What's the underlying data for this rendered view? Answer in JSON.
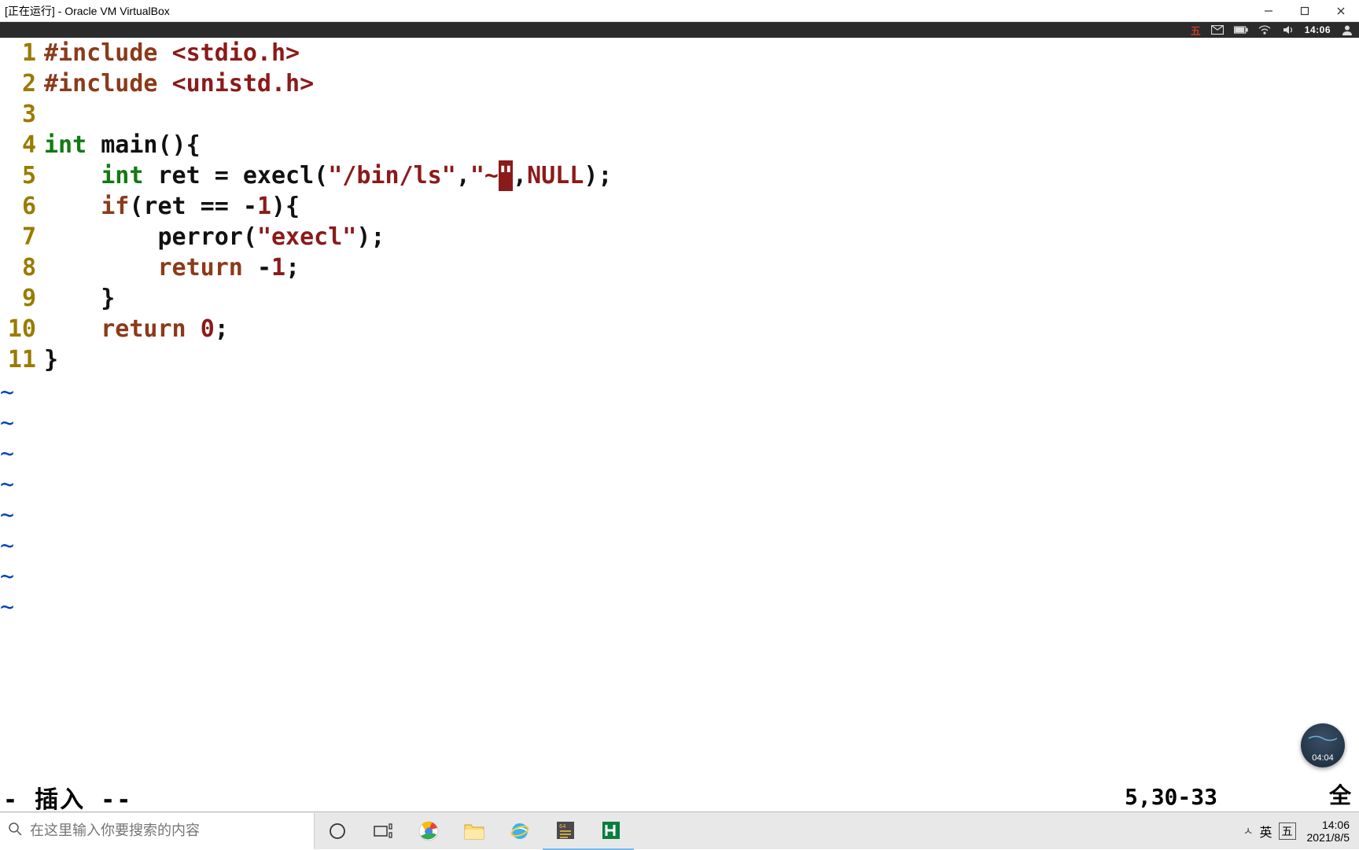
{
  "window": {
    "title": "[正在运行] - Oracle VM VirtualBox"
  },
  "vm_top": {
    "ime_indicator": "五",
    "time": "14:06"
  },
  "code": {
    "lines": [
      "1",
      "2",
      "3",
      "4",
      "5",
      "6",
      "7",
      "8",
      "9",
      "10",
      "11"
    ],
    "l1_inc": "#include ",
    "l1_hdr": "<stdio.h>",
    "l2_inc": "#include ",
    "l2_hdr": "<unistd.h>",
    "l4_type": "int",
    "l4_rest": " main(){",
    "l5_indent": "    ",
    "l5_type": "int",
    "l5_a": " ret = execl(",
    "l5_s1": "\"/bin/ls\"",
    "l5_c1": ",",
    "l5_s2a": "\"~",
    "l5_cursor": "\"",
    "l5_c2": ",",
    "l5_null": "NULL",
    "l5_end": ");",
    "l6_indent": "    ",
    "l6_if": "if",
    "l6_rest_a": "(ret == ",
    "l6_neg": "-",
    "l6_num": "1",
    "l6_rest_b": "){",
    "l7_indent": "        ",
    "l7_call": "perror(",
    "l7_str": "\"execl\"",
    "l7_end": ");",
    "l8_indent": "        ",
    "l8_ret": "return",
    "l8_sp": " ",
    "l8_neg": "-",
    "l8_num": "1",
    "l8_end": ";",
    "l9_indent": "    ",
    "l9_brace": "}",
    "l10_indent": "    ",
    "l10_ret": "return",
    "l10_sp": " ",
    "l10_num": "0",
    "l10_end": ";",
    "l11_brace": "}"
  },
  "vim": {
    "mode": "- 插入 --",
    "pos": "5,30-33",
    "pct": "全"
  },
  "taskbar": {
    "search_placeholder": "在这里输入你要搜索的内容",
    "ime_caret": "ㅅ",
    "ime_lang": "英",
    "ime_mode": "五",
    "clock_time": "14:06",
    "clock_date": "2021/8/5"
  },
  "badge": {
    "time": "04:04"
  }
}
